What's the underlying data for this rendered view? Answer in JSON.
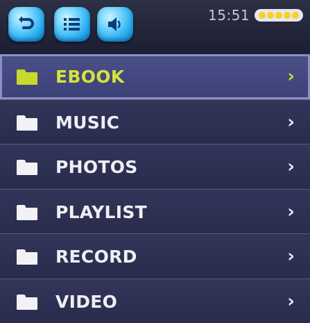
{
  "statusbar": {
    "time": "15:51",
    "battery_level": 1.0,
    "buttons": [
      {
        "icon": "back-icon"
      },
      {
        "icon": "list-icon"
      },
      {
        "icon": "speaker-icon"
      }
    ]
  },
  "menu": {
    "items": [
      {
        "label": "EBOOK",
        "selected": true
      },
      {
        "label": "MUSIC"
      },
      {
        "label": "PHOTOS"
      },
      {
        "label": "PLAYLIST"
      },
      {
        "label": "RECORD"
      },
      {
        "label": "VIDEO"
      }
    ],
    "chevron": "›"
  },
  "colors": {
    "accent": "#c8d82c",
    "button": "#22a8ec",
    "background": "#292c4c"
  }
}
